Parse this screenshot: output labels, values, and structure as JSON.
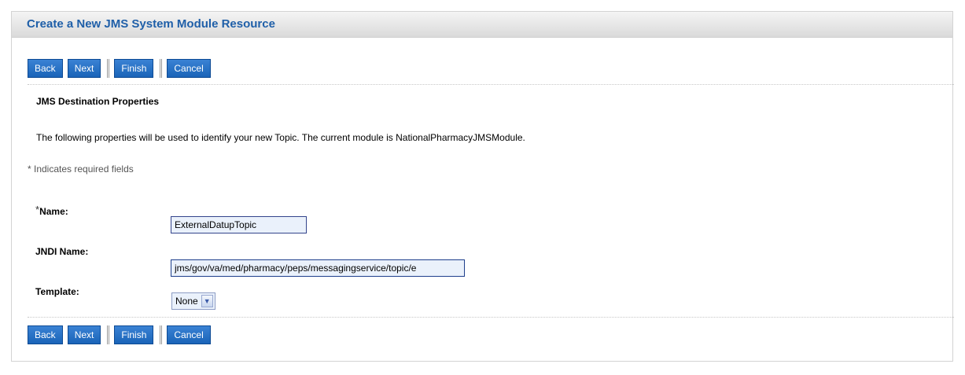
{
  "panel": {
    "title": "Create a New JMS System Module Resource"
  },
  "buttons": {
    "back": "Back",
    "next": "Next",
    "finish": "Finish",
    "cancel": "Cancel"
  },
  "section": {
    "title": "JMS Destination Properties",
    "description": "The following properties will be used to identify your new Topic. The current module is NationalPharmacyJMSModule.",
    "required_note": "* Indicates required fields"
  },
  "fields": {
    "name": {
      "required_mark": "*",
      "label": "Name:",
      "value": "ExternalDatupTopic"
    },
    "jndi": {
      "label": "JNDI Name:",
      "value": "jms/gov/va/med/pharmacy/peps/messagingservice/topic/e"
    },
    "template": {
      "label": "Template:",
      "selected": "None",
      "arrow_icon": "chevron-down-icon"
    }
  },
  "colors": {
    "header_text": "#1f5fa8",
    "button_bg": "#1a64b8",
    "input_bg": "#eaf1fb"
  }
}
